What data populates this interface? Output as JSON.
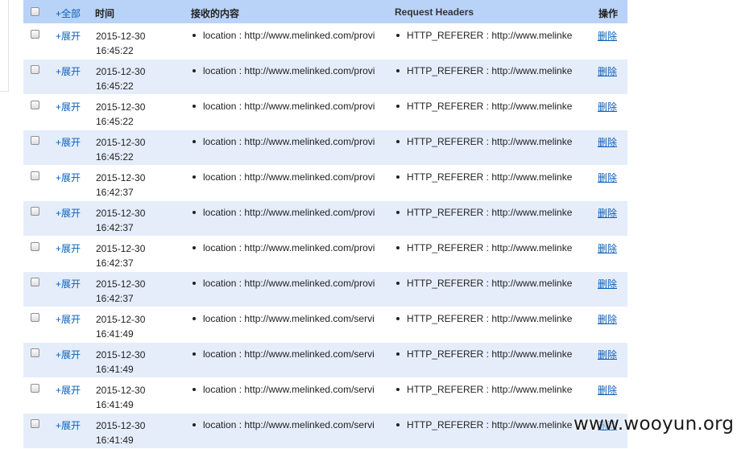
{
  "header": {
    "expand_all": "+全部",
    "time": "时间",
    "content": "接收的内容",
    "request_headers": "Request Headers",
    "operation": "操作"
  },
  "rows": [
    {
      "expand": "+展开",
      "date": "2015-12-30",
      "time": "16:45:22",
      "content": "location : http://www.melinked.com/provi",
      "header": "HTTP_REFERER : http://www.melinke",
      "delete": "删除"
    },
    {
      "expand": "+展开",
      "date": "2015-12-30",
      "time": "16:45:22",
      "content": "location : http://www.melinked.com/provi",
      "header": "HTTP_REFERER : http://www.melinke",
      "delete": "删除"
    },
    {
      "expand": "+展开",
      "date": "2015-12-30",
      "time": "16:45:22",
      "content": "location : http://www.melinked.com/provi",
      "header": "HTTP_REFERER : http://www.melinke",
      "delete": "删除"
    },
    {
      "expand": "+展开",
      "date": "2015-12-30",
      "time": "16:45:22",
      "content": "location : http://www.melinked.com/provi",
      "header": "HTTP_REFERER : http://www.melinke",
      "delete": "删除"
    },
    {
      "expand": "+展开",
      "date": "2015-12-30",
      "time": "16:42:37",
      "content": "location : http://www.melinked.com/provi",
      "header": "HTTP_REFERER : http://www.melinke",
      "delete": "删除"
    },
    {
      "expand": "+展开",
      "date": "2015-12-30",
      "time": "16:42:37",
      "content": "location : http://www.melinked.com/provi",
      "header": "HTTP_REFERER : http://www.melinke",
      "delete": "删除"
    },
    {
      "expand": "+展开",
      "date": "2015-12-30",
      "time": "16:42:37",
      "content": "location : http://www.melinked.com/provi",
      "header": "HTTP_REFERER : http://www.melinke",
      "delete": "删除"
    },
    {
      "expand": "+展开",
      "date": "2015-12-30",
      "time": "16:42:37",
      "content": "location : http://www.melinked.com/provi",
      "header": "HTTP_REFERER : http://www.melinke",
      "delete": "删除"
    },
    {
      "expand": "+展开",
      "date": "2015-12-30",
      "time": "16:41:49",
      "content": "location : http://www.melinked.com/servi",
      "header": "HTTP_REFERER : http://www.melinke",
      "delete": "删除"
    },
    {
      "expand": "+展开",
      "date": "2015-12-30",
      "time": "16:41:49",
      "content": "location : http://www.melinked.com/servi",
      "header": "HTTP_REFERER : http://www.melinke",
      "delete": "删除"
    },
    {
      "expand": "+展开",
      "date": "2015-12-30",
      "time": "16:41:49",
      "content": "location : http://www.melinked.com/servi",
      "header": "HTTP_REFERER : http://www.melinke",
      "delete": "删除"
    },
    {
      "expand": "+展开",
      "date": "2015-12-30",
      "time": "16:41:49",
      "content": "location : http://www.melinked.com/servi",
      "header": "HTTP_REFERER : http://www.melinke",
      "delete": "删除"
    }
  ],
  "watermark": "www.wooyun.org",
  "colors": {
    "header_bg": "#b9d3f8",
    "row_alt_bg": "#e5edfb",
    "link": "#0b5fb8"
  }
}
